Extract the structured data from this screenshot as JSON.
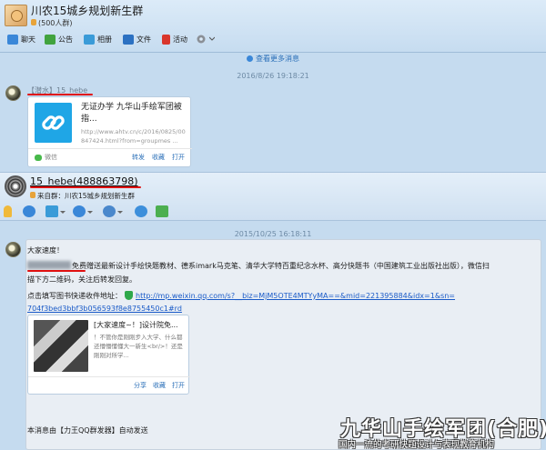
{
  "group": {
    "name": "川农15城乡规划新生群",
    "member_count": "(500人群)"
  },
  "toolbar": {
    "items": [
      {
        "label": "聊天",
        "icon": "chat-icon",
        "color": "#3a87d8"
      },
      {
        "label": "公告",
        "icon": "announcement-icon",
        "color": "#41a33e"
      },
      {
        "label": "相册",
        "icon": "album-icon",
        "color": "#3a9bd8"
      },
      {
        "label": "文件",
        "icon": "folder-icon",
        "color": "#2c71c2"
      },
      {
        "label": "活动",
        "icon": "flag-icon",
        "color": "#d9362c"
      }
    ]
  },
  "history_link": "查看更多消息",
  "message1": {
    "timestamp": "2016/8/26 19:18:21",
    "sender": "【潜水】15_hebe",
    "card": {
      "title": "无证办学 九华山手绘军团被指...",
      "url": "http://www.ahtv.cn/c/2016/0825/00847424.html?from=groupmes ...",
      "source": "微信",
      "actions": [
        "转发",
        "收藏",
        "打开"
      ]
    }
  },
  "contact": {
    "name": "15_hebe(488863798)",
    "from": "来自群：川农15城乡规划新生群"
  },
  "message2": {
    "timestamp": "2015/10/25 16:18:11",
    "greeting": "大家速度！",
    "line1_after_blur": "免费赠送最新设计手绘快题教材、德系imark马克笔、清华大学特百重纪念水杯、高分快题书（中国建筑工业出版社出版），微信扫",
    "line2": "描下方二维码，关注后转发回复。",
    "link_label": "点击填写图书快递收件地址：",
    "link_url_1": "http://mp.weixin.qq.com/s?__biz=MjM5OTE4MTYyMA==&mid=221395884&idx=1&sn=",
    "link_url_2": "704f3bed3bbf3b056593f8e8755450c1#rd",
    "card": {
      "title": "[大家速度~！]设计院免...",
      "desc": "！不管你是刚刚步入大学、什么都还懵懵懂懂大一新生<br/>！还是刚刚对所学...",
      "actions": [
        "分享",
        "收藏",
        "打开"
      ]
    },
    "footer": "本消息由【力王QQ群发器】自动发送"
  },
  "watermark": {
    "title": "九华山手绘军团(合肥)",
    "subtitle": "国内一流的考研快题设计与表现教育机构"
  }
}
